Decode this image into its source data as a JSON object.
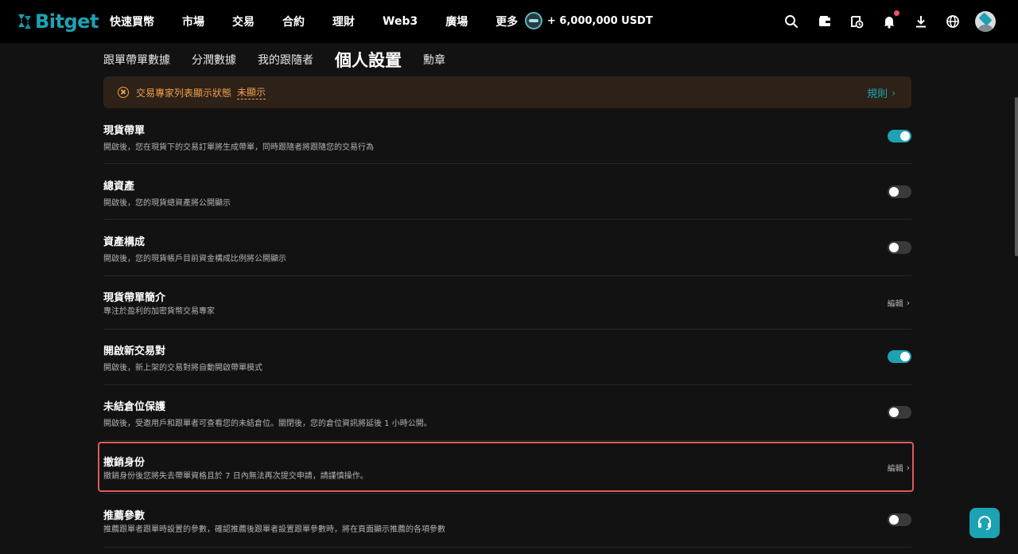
{
  "brand": {
    "name": "Bitget",
    "accent": "#1da2b4"
  },
  "nav": {
    "items": [
      "快速買幣",
      "市場",
      "交易",
      "合約",
      "理財",
      "Web3",
      "廣場",
      "更多"
    ],
    "promo": "+ 6,000,000 USDT"
  },
  "header_icons": [
    "search-icon",
    "wallet-icon",
    "history-icon",
    "bell-icon",
    "download-icon",
    "globe-icon",
    "avatar"
  ],
  "subtabs": {
    "items": [
      "跟單帶單數據",
      "分潤數據",
      "我的跟隨者",
      "個人設置",
      "勳章"
    ],
    "active": "個人設置"
  },
  "alert": {
    "text": "交易專家列表顯示狀態",
    "status": "未顯示",
    "rules": "規則"
  },
  "settings": [
    {
      "title": "現貨帶單",
      "desc": "開啟後，您在現貨下的交易訂單將生成帶單，同時跟隨者將跟隨您的交易行為",
      "control": "toggle",
      "on": true
    },
    {
      "title": "總資產",
      "desc": "開啟後，您的現貨總資產將公開顯示",
      "control": "toggle",
      "on": false
    },
    {
      "title": "資產構成",
      "desc": "開啟後，您的現貨帳戶目前資金構成比例將公開顯示",
      "control": "toggle",
      "on": false
    },
    {
      "title": "現貨帶單簡介",
      "desc": "專注於盈利的加密貨幣交易專家",
      "control": "edit",
      "edit_label": "編輯"
    },
    {
      "title": "開啟新交易對",
      "desc": "開啟後，新上架的交易對將自動開啟帶單模式",
      "control": "toggle",
      "on": true
    },
    {
      "title": "未結倉位保護",
      "desc": "開啟後，受邀用戶和跟單者可查看您的未結倉位。關閉後，您的倉位資訊將延後 1 小時公開。",
      "control": "toggle",
      "on": false
    },
    {
      "title": "撤銷身份",
      "desc": "撤銷身份後您將失去帶單資格且於 7 日內無法再次提交申請，請謹慎操作。",
      "control": "edit",
      "edit_label": "編輯"
    },
    {
      "title": "推薦參數",
      "desc": "推薦跟單者跟單時設置的參數，確認推薦後跟單者設置跟單參數時，將在頁面顯示推薦的各項參數",
      "control": "toggle",
      "on": false
    }
  ]
}
